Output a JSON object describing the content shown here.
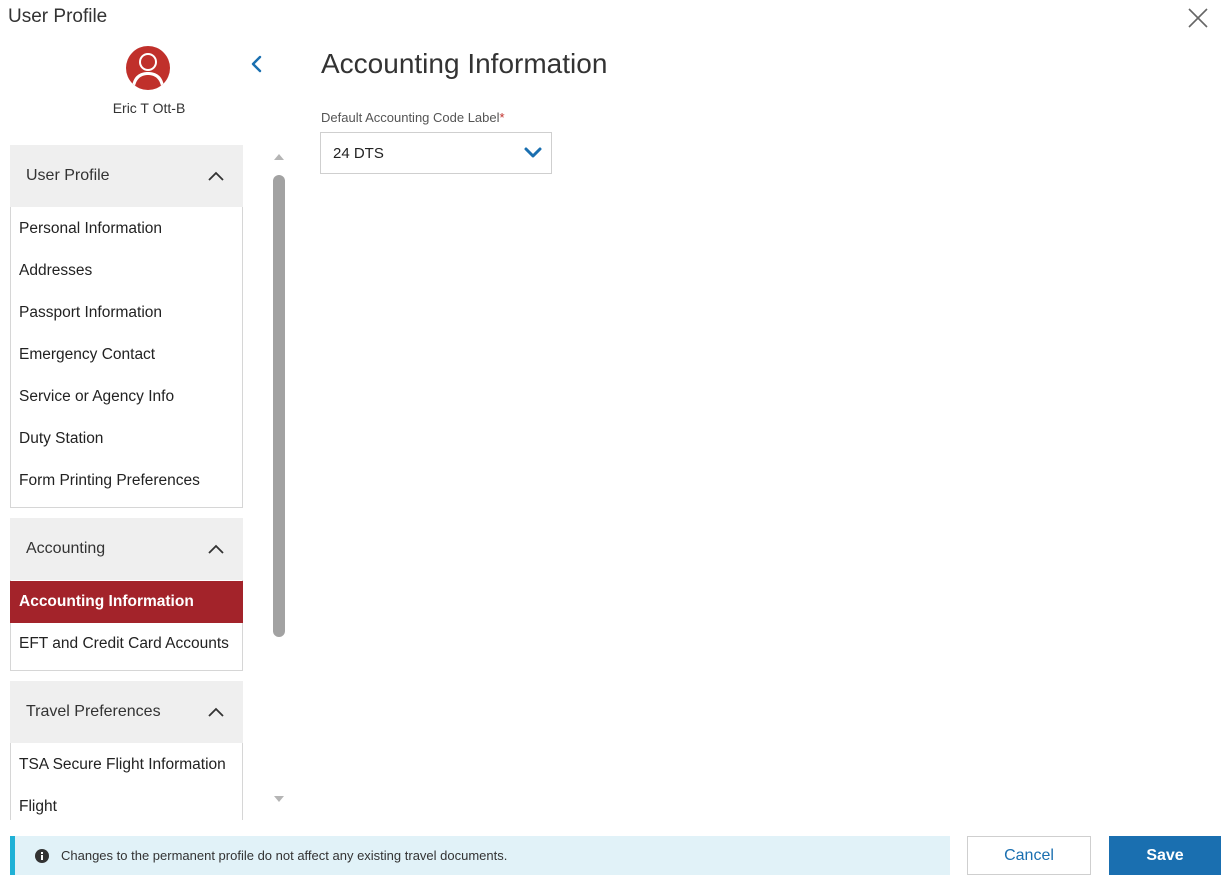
{
  "window": {
    "title": "User Profile",
    "close_icon": "close-icon"
  },
  "user": {
    "name": "Eric T Ott-B",
    "avatar_icon": "user-avatar-icon",
    "avatar_color": "#c0302b"
  },
  "sidebar": {
    "collapse_icon": "chevron-left-icon",
    "sections": [
      {
        "label": "User Profile",
        "icon": "chevron-up-icon",
        "items": [
          "Personal Information",
          "Addresses",
          "Passport Information",
          "Emergency Contact",
          "Service or Agency Info",
          "Duty Station",
          "Form Printing Preferences"
        ]
      },
      {
        "label": "Accounting",
        "icon": "chevron-up-icon",
        "items": [
          "Accounting Information",
          "EFT and Credit Card Accounts"
        ],
        "active_item": "Accounting Information"
      },
      {
        "label": "Travel Preferences",
        "icon": "chevron-up-icon",
        "items": [
          "TSA Secure Flight Information",
          "Flight"
        ]
      }
    ]
  },
  "main": {
    "title": "Accounting Information",
    "field": {
      "label": "Default Accounting Code Label",
      "required_mark": "*",
      "value": "24 DTS"
    }
  },
  "footer": {
    "info_text": "Changes to the permanent profile do not affect any existing travel documents.",
    "cancel_label": "Cancel",
    "save_label": "Save"
  },
  "colors": {
    "accent": "#1a6fb0",
    "active_nav": "#a3232a",
    "info_bg": "#e1f2f8",
    "info_border": "#20b1d6"
  }
}
